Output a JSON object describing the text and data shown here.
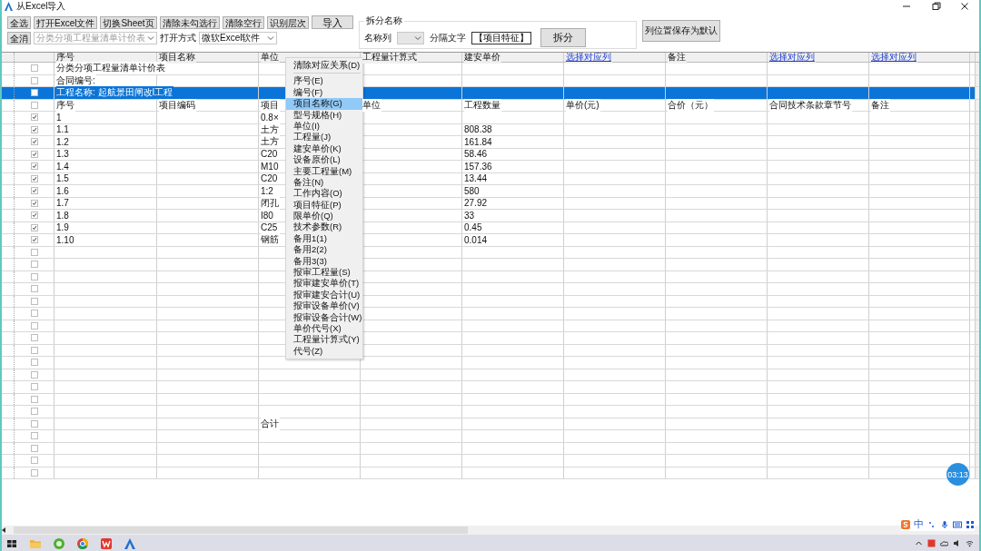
{
  "window": {
    "title": "从Excel导入"
  },
  "toolbar": {
    "row1": [
      {
        "label": "全选"
      },
      {
        "label": "打开Excel文件"
      },
      {
        "label": "切换Sheet页"
      },
      {
        "label": "清除未勾选行"
      },
      {
        "label": "清除空行"
      },
      {
        "label": "识别层次"
      }
    ],
    "import_button": "导入",
    "deselect_button": "全消",
    "sheet_combo": {
      "value": "分类分项工程量清单计价表",
      "disabled": true
    },
    "open_mode_label": "打开方式",
    "open_mode_combo": {
      "value": "微软Excel软件",
      "disabled": false
    }
  },
  "split_group": {
    "title": "拆分名称",
    "column_label": "名称列",
    "separator_label": "分隔文字",
    "separator_value": "【项目特征】",
    "split_button": "拆分"
  },
  "save_layout_button": "列位置保存为默认",
  "grid": {
    "columns": [
      {
        "label": "序号",
        "kind": "plain"
      },
      {
        "label": "项目名称",
        "kind": "plain"
      },
      {
        "label": "单位",
        "kind": "plain"
      },
      {
        "label": "工程量计算式",
        "kind": "plain"
      },
      {
        "label": "建安单价",
        "kind": "plain"
      },
      {
        "label": "选择对应列",
        "kind": "link"
      },
      {
        "label": "备注",
        "kind": "plain"
      },
      {
        "label": "选择对应列",
        "kind": "link"
      },
      {
        "label": "选择对应列",
        "kind": "link"
      }
    ],
    "rows": [
      {
        "checked": false,
        "selected": false,
        "column_1": "分类分项工程量清单计价表"
      },
      {
        "checked": false,
        "selected": false,
        "column_1": "合同编号:"
      },
      {
        "checked": false,
        "selected": true,
        "column_1": "工程名称: 起航景田闸改I工程"
      },
      {
        "checked": false,
        "selected": false,
        "column_1": "序号",
        "column_2": "项目编码",
        "column_3": "项目",
        "column_4": "单位",
        "column_5": "工程数量",
        "column_6": "单价(元)",
        "column_7": "合价（元）",
        "column_8": "合同技术条款章节号",
        "column_9": "备注"
      },
      {
        "checked": true,
        "selected": false,
        "column_1": "1",
        "column_3": "0.8×"
      },
      {
        "checked": true,
        "selected": false,
        "column_1": "1.1",
        "column_3": "土方",
        "column_5": "808.38"
      },
      {
        "checked": true,
        "selected": false,
        "column_1": "1.2",
        "column_3": "土方",
        "column_5": "161.84"
      },
      {
        "checked": true,
        "selected": false,
        "column_1": "1.3",
        "column_3": "C20",
        "column_5": "58.46"
      },
      {
        "checked": true,
        "selected": false,
        "column_1": "1.4",
        "column_3": "M10",
        "column_5": "157.36"
      },
      {
        "checked": true,
        "selected": false,
        "column_1": "1.5",
        "column_3": "C20",
        "column_5": "13.44"
      },
      {
        "checked": true,
        "selected": false,
        "column_1": "1.6",
        "column_3": "1:2",
        "column_5": "580"
      },
      {
        "checked": true,
        "selected": false,
        "column_1": "1.7",
        "column_3": "闭孔",
        "column_5": "27.92"
      },
      {
        "checked": true,
        "selected": false,
        "column_1": "1.8",
        "column_3": "I80",
        "column_5": "33"
      },
      {
        "checked": true,
        "selected": false,
        "column_1": "1.9",
        "column_3": "C25",
        "column_5": "0.45"
      },
      {
        "checked": true,
        "selected": false,
        "column_1": "1.10",
        "column_3": "钢筋",
        "column_5": "0.014"
      },
      {
        "checked": false,
        "selected": false
      },
      {
        "checked": false,
        "selected": false
      },
      {
        "checked": false,
        "selected": false
      },
      {
        "checked": false,
        "selected": false
      },
      {
        "checked": false,
        "selected": false
      },
      {
        "checked": false,
        "selected": false
      },
      {
        "checked": false,
        "selected": false
      },
      {
        "checked": false,
        "selected": false
      },
      {
        "checked": false,
        "selected": false
      },
      {
        "checked": false,
        "selected": false
      },
      {
        "checked": false,
        "selected": false
      },
      {
        "checked": false,
        "selected": false
      },
      {
        "checked": false,
        "selected": false
      },
      {
        "checked": false,
        "selected": false
      },
      {
        "checked": false,
        "selected": false,
        "column_3": "合计"
      },
      {
        "checked": false,
        "selected": false
      },
      {
        "checked": false,
        "selected": false
      },
      {
        "checked": false,
        "selected": false
      },
      {
        "checked": false,
        "selected": false
      }
    ]
  },
  "context_menu": {
    "items": [
      {
        "kind": "action",
        "label": "清除对应关系(D)",
        "selected": false
      },
      {
        "kind": "separator"
      },
      {
        "kind": "field",
        "label": "序号(E)",
        "selected": false
      },
      {
        "kind": "field",
        "label": "编号(F)",
        "selected": false
      },
      {
        "kind": "field",
        "label": "项目名称(G)",
        "selected": true
      },
      {
        "kind": "field",
        "label": "型号规格(H)",
        "selected": false
      },
      {
        "kind": "field",
        "label": "单位(I)",
        "selected": false
      },
      {
        "kind": "field",
        "label": "工程量(J)",
        "selected": false
      },
      {
        "kind": "field",
        "label": "建安单价(K)",
        "selected": false
      },
      {
        "kind": "field",
        "label": "设备原价(L)",
        "selected": false
      },
      {
        "kind": "field",
        "label": "主要工程量(M)",
        "selected": false
      },
      {
        "kind": "field",
        "label": "备注(N)",
        "selected": false
      },
      {
        "kind": "field",
        "label": "工作内容(O)",
        "selected": false
      },
      {
        "kind": "field",
        "label": "项目特征(P)",
        "selected": false
      },
      {
        "kind": "field",
        "label": "限单价(Q)",
        "selected": false
      },
      {
        "kind": "field",
        "label": "技术参数(R)",
        "selected": false
      },
      {
        "kind": "field",
        "label": "备用1(1)",
        "selected": false
      },
      {
        "kind": "field",
        "label": "备用2(2)",
        "selected": false
      },
      {
        "kind": "field",
        "label": "备用3(3)",
        "selected": false
      },
      {
        "kind": "field",
        "label": "报审工程量(S)",
        "selected": false
      },
      {
        "kind": "field",
        "label": "报审建安单价(T)",
        "selected": false
      },
      {
        "kind": "field",
        "label": "报审建安合计(U)",
        "selected": false
      },
      {
        "kind": "field",
        "label": "报审设备单价(V)",
        "selected": false
      },
      {
        "kind": "field",
        "label": "报审设备合计(W)",
        "selected": false
      },
      {
        "kind": "field",
        "label": "单价代号(X)",
        "selected": false
      },
      {
        "kind": "field",
        "label": "工程量计算式(Y)",
        "selected": false
      },
      {
        "kind": "field",
        "label": "代号(Z)",
        "selected": false
      }
    ]
  },
  "recorder_badge": "03:13",
  "ime_bar": {
    "mode": "中"
  }
}
